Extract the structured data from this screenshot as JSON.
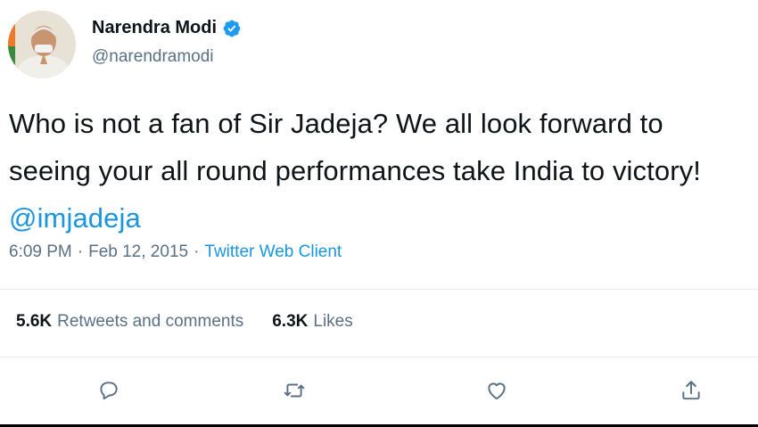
{
  "user": {
    "name": "Narendra Modi",
    "handle": "@narendramodi"
  },
  "tweet": {
    "text": "Who is not a fan of Sir Jadeja? We all look forward to seeing your all round performances take India to victory! ",
    "mention": "@imjadeja"
  },
  "meta": {
    "time": "6:09 PM",
    "separator1": "·",
    "date": "Feb 12, 2015",
    "separator2": "·",
    "client": "Twitter Web Client"
  },
  "stats": {
    "retweets_count": "5.6K",
    "retweets_label": "Retweets and comments",
    "likes_count": "6.3K",
    "likes_label": "Likes"
  },
  "icons": {
    "reply": "reply-icon",
    "retweet": "retweet-icon",
    "like": "heart-icon",
    "share": "share-icon",
    "verified": "verified-badge-icon"
  },
  "colors": {
    "link": "#1b95e0",
    "secondary": "#5b7083",
    "text": "#0f1419"
  }
}
